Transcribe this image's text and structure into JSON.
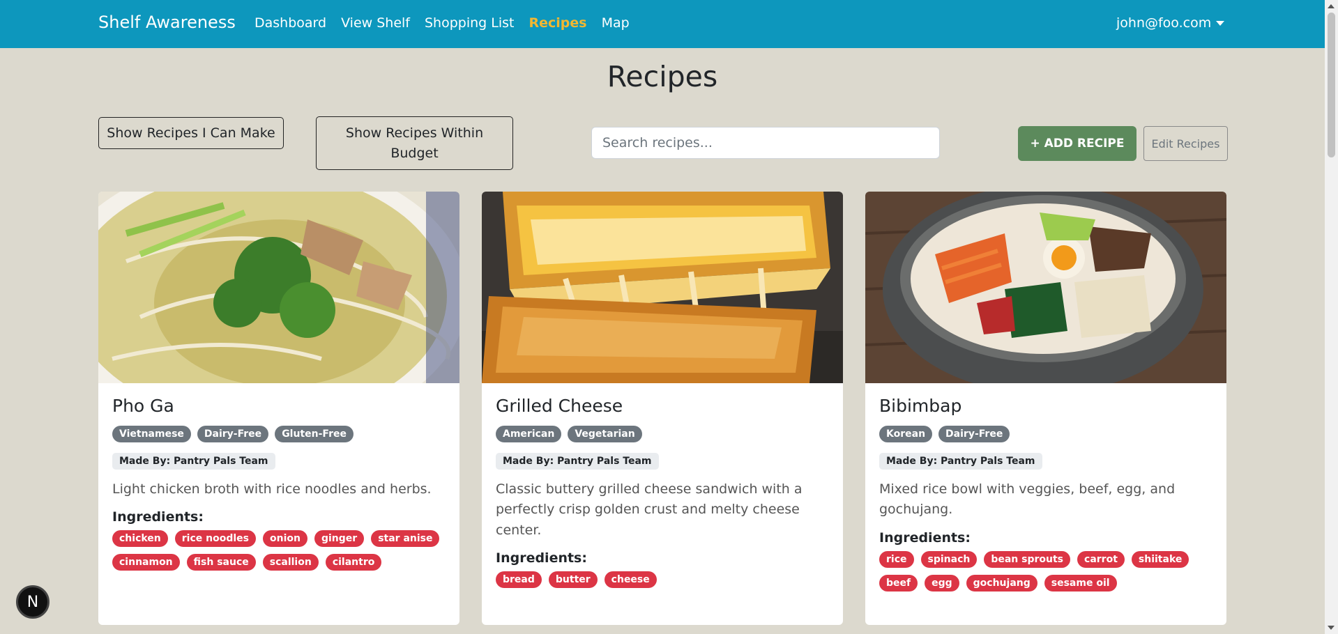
{
  "nav": {
    "brand": "Shelf Awareness",
    "links": [
      {
        "label": "Dashboard"
      },
      {
        "label": "View Shelf"
      },
      {
        "label": "Shopping List"
      },
      {
        "label": "Recipes"
      },
      {
        "label": "Map"
      }
    ],
    "active": "Recipes",
    "user": "john@foo.com"
  },
  "page": {
    "title": "Recipes",
    "btn_can_make": "Show Recipes I Can Make",
    "btn_budget": "Show Recipes Within Budget",
    "search_placeholder": "Search recipes...",
    "btn_add": "+ ADD RECIPE",
    "btn_edit": "Edit Recipes"
  },
  "recipes": [
    {
      "title": "Pho Ga",
      "tags": [
        "Vietnamese",
        "Dairy-Free",
        "Gluten-Free"
      ],
      "made_by": "Made By: Pantry Pals Team",
      "description": "Light chicken broth with rice noodles and herbs.",
      "ingredients_label": "Ingredients:",
      "ingredients": [
        "chicken",
        "rice noodles",
        "onion",
        "ginger",
        "star anise",
        "cinnamon",
        "fish sauce",
        "scallion",
        "cilantro"
      ]
    },
    {
      "title": "Grilled Cheese",
      "tags": [
        "American",
        "Vegetarian"
      ],
      "made_by": "Made By: Pantry Pals Team",
      "description": "Classic buttery grilled cheese sandwich with a perfectly crisp golden crust and melty cheese center.",
      "ingredients_label": "Ingredients:",
      "ingredients": [
        "bread",
        "butter",
        "cheese"
      ]
    },
    {
      "title": "Bibimbap",
      "tags": [
        "Korean",
        "Dairy-Free"
      ],
      "made_by": "Made By: Pantry Pals Team",
      "description": "Mixed rice bowl with veggies, beef, egg, and gochujang.",
      "ingredients_label": "Ingredients:",
      "ingredients": [
        "rice",
        "spinach",
        "bean sprouts",
        "carrot",
        "shiitake",
        "beef",
        "egg",
        "gochujang",
        "sesame oil"
      ]
    }
  ],
  "next_badge": "N",
  "colors": {
    "navbar": "#0d97bd",
    "active_link": "#f2b731",
    "background": "#dcd9ce",
    "add_button": "#5c8a5c",
    "ingredient_badge": "#dc3545",
    "tag_badge": "#6c757d"
  }
}
